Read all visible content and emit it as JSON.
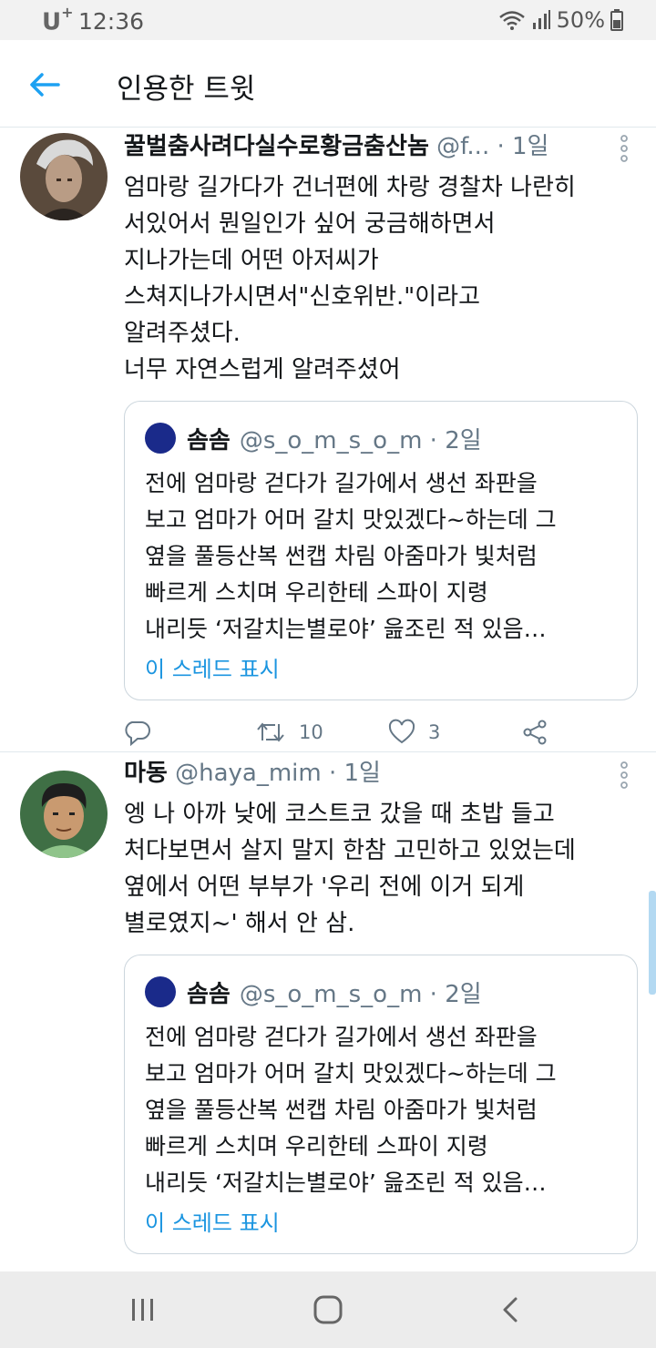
{
  "status_bar": {
    "carrier": "U",
    "carrier_sup": "+",
    "time": "12:36",
    "battery": "50%"
  },
  "header": {
    "title": "인용한 트윗"
  },
  "tweets": [
    {
      "name": "꿀벌춤사려다실수로황금춤산놈",
      "handle": "@f...",
      "time": "· 1일",
      "text": "엄마랑 길가다가 건너편에 차랑 경찰차 나란히\n서있어서 뭔일인가 싶어 궁금해하면서\n지나가는데 어떤 아저씨가\n스쳐지나가시면서\"신호위반.\"이라고\n알려주셨다.\n너무 자연스럽게 알려주셨어",
      "quote": {
        "name": "솜솜",
        "handle": "@s_o_m_s_o_m · 2일",
        "text": "전에 엄마랑 걷다가 길가에서 생선 좌판을\n보고 엄마가 어머 갈치 맛있겠다~하는데 그\n옆을 풀등산복 썬캡 차림 아줌마가 빛처럼\n빠르게 스치며 우리한테 스파이 지령\n내리듯 ‘저갈치는별로야’ 읊조린 적 있음…",
        "link": "이 스레드 표시"
      },
      "retweets": "10",
      "likes": "3"
    },
    {
      "name": "마동",
      "handle": "@haya_mim · 1일",
      "text": "엥 나 아까 낮에 코스트코 갔을 때 초밥 들고\n처다보면서 살지 말지 한참 고민하고 있었는데\n옆에서 어떤 부부가 '우리 전에 이거 되게\n별로였지~' 해서 안 삼.",
      "quote": {
        "name": "솜솜",
        "handle": "@s_o_m_s_o_m · 2일",
        "text": "전에 엄마랑 걷다가 길가에서 생선 좌판을\n보고 엄마가 어머 갈치 맛있겠다~하는데 그\n옆을 풀등산복 썬캡 차림 아줌마가 빛처럼\n빠르게 스치며 우리한테 스파이 지령\n내리듯 ‘저갈치는별로야’ 읊조린 적 있음…",
        "link": "이 스레드 표시"
      }
    }
  ],
  "icons": {
    "back": "arrow-left-icon",
    "reply": "reply-icon",
    "retweet": "retweet-icon",
    "like": "heart-icon",
    "share": "share-icon",
    "more": "more-vertical-icon"
  },
  "colors": {
    "accent": "#1da1f2",
    "link": "#1b95e0",
    "secondary_text": "#657786",
    "divider": "#e1e8ed"
  }
}
